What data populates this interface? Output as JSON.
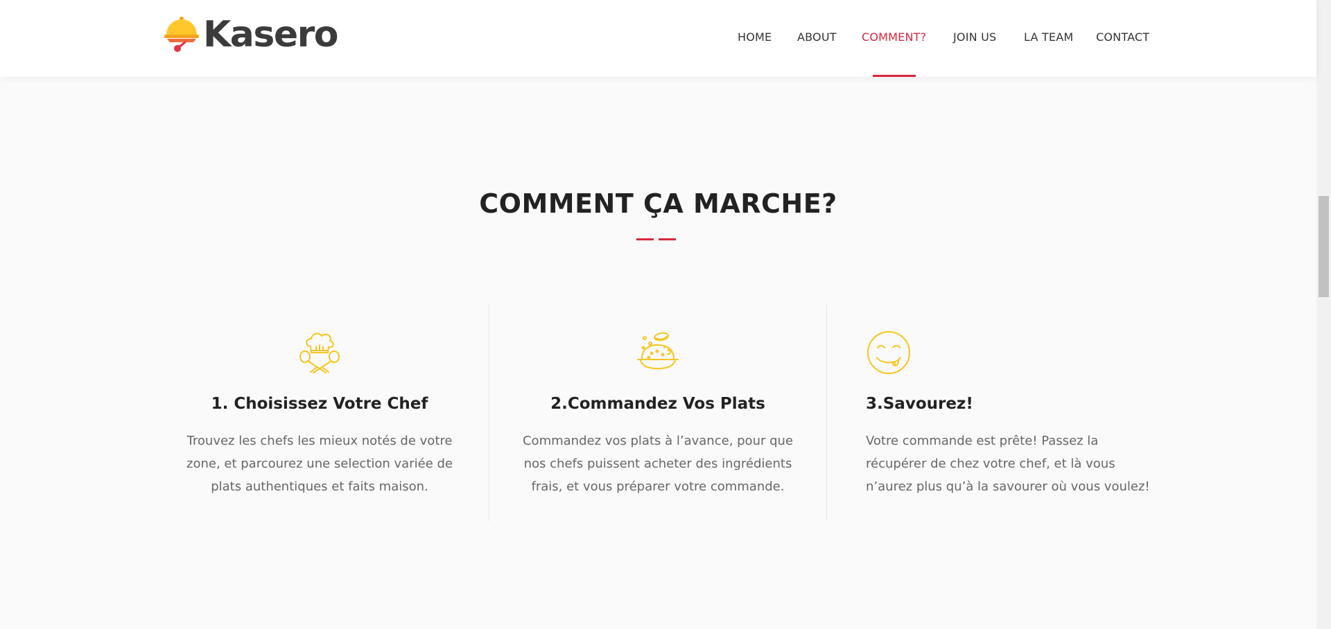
{
  "brand": {
    "name": "Kasero"
  },
  "nav": {
    "items": [
      {
        "label": "HOME"
      },
      {
        "label": "ABOUT"
      },
      {
        "label": "COMMENT?"
      },
      {
        "label": "JOIN US"
      },
      {
        "label": "LA TEAM"
      },
      {
        "label": "CONTACT"
      }
    ],
    "active_index": 2
  },
  "section": {
    "title": "COMMENT ÇA MARCHE?"
  },
  "steps": [
    {
      "icon": "chef-hat-utensils-icon",
      "title": "1. Choisissez Votre Chef",
      "lines": [
        "Trouvez les chefs les mieux notés de votre",
        "zone, et parcourez une selection variée de",
        "plats authentiques et faits maison."
      ]
    },
    {
      "icon": "food-plate-icon",
      "title": "2.Commandez Vos Plats",
      "lines": [
        "Commandez vos plats à l’avance, pour que",
        "nos chefs puissent acheter des ingrédients",
        "frais, et vous préparer votre commande."
      ]
    },
    {
      "icon": "yummy-face-icon",
      "title": "3.Savourez!",
      "lines": [
        "Votre commande est prête! Passez la",
        "récupérer de chez votre chef, et là vous",
        "n’aurez plus qu’à la savourer où vous voulez!"
      ]
    }
  ],
  "colors": {
    "accent": "#d7263d",
    "icon_yellow": "#f7c51e",
    "logo_yellow": "#ffc72c",
    "logo_orange": "#f26b3a",
    "logo_red": "#e0354b",
    "text_dark": "#222222",
    "text_body": "#666666"
  }
}
